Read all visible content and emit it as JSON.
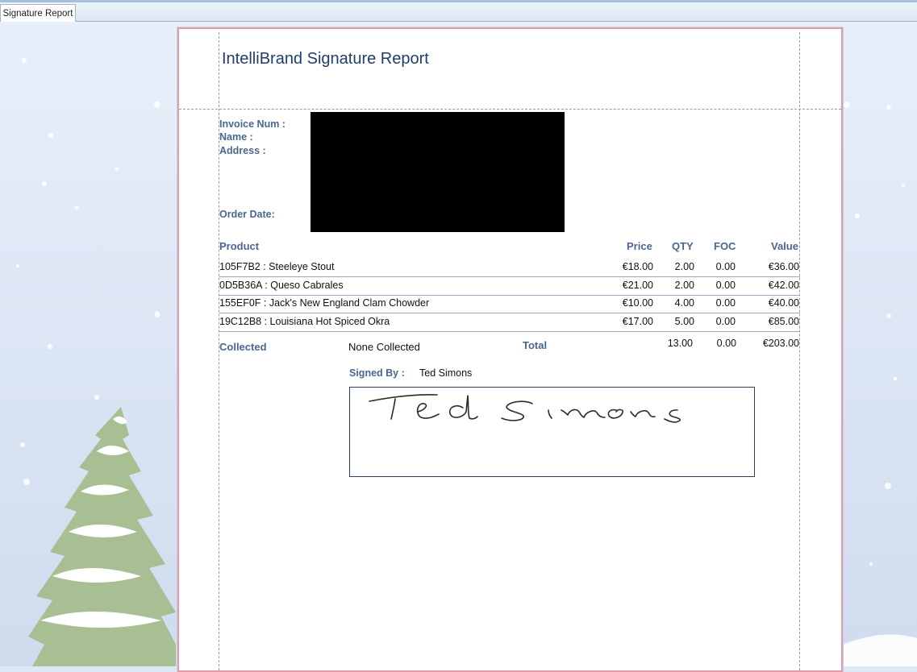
{
  "tab": {
    "label": "Signature Report"
  },
  "report": {
    "title": "IntelliBrand Signature Report",
    "labels": {
      "invoice_num": "Invoice Num :",
      "name": "Name :",
      "address": "Address :",
      "order_date": "Order Date:"
    },
    "columns": {
      "product": "Product",
      "price": "Price",
      "qty": "QTY",
      "foc": "FOC",
      "value": "Value"
    },
    "rows": [
      {
        "product": "105F7B2 : Steeleye Stout",
        "price": "€18.00",
        "qty": "2.00",
        "foc": "0.00",
        "value": "€36.00"
      },
      {
        "product": "0D5B36A : Queso Cabrales",
        "price": "€21.00",
        "qty": "2.00",
        "foc": "0.00",
        "value": "€42.00"
      },
      {
        "product": "155EF0F : Jack's New England Clam Chowder",
        "price": "€10.00",
        "qty": "4.00",
        "foc": "0.00",
        "value": "€40.00"
      },
      {
        "product": "19C12B8 : Louisiana Hot Spiced Okra",
        "price": "€17.00",
        "qty": "5.00",
        "foc": "0.00",
        "value": "€85.00"
      }
    ],
    "summary": {
      "collected_label": "Collected",
      "collected_value": "None Collected",
      "total_label": "Total",
      "total_qty": "13.00",
      "total_foc": "0.00",
      "total_value": "€203.00"
    },
    "signed_by_label": "Signed By :",
    "signed_by_value": "Ted Simons"
  },
  "colors": {
    "label_blue": "#4a6690",
    "title_blue": "#1f3f68",
    "page_border": "#e49aa9",
    "tree_green": "#a8bf94"
  }
}
